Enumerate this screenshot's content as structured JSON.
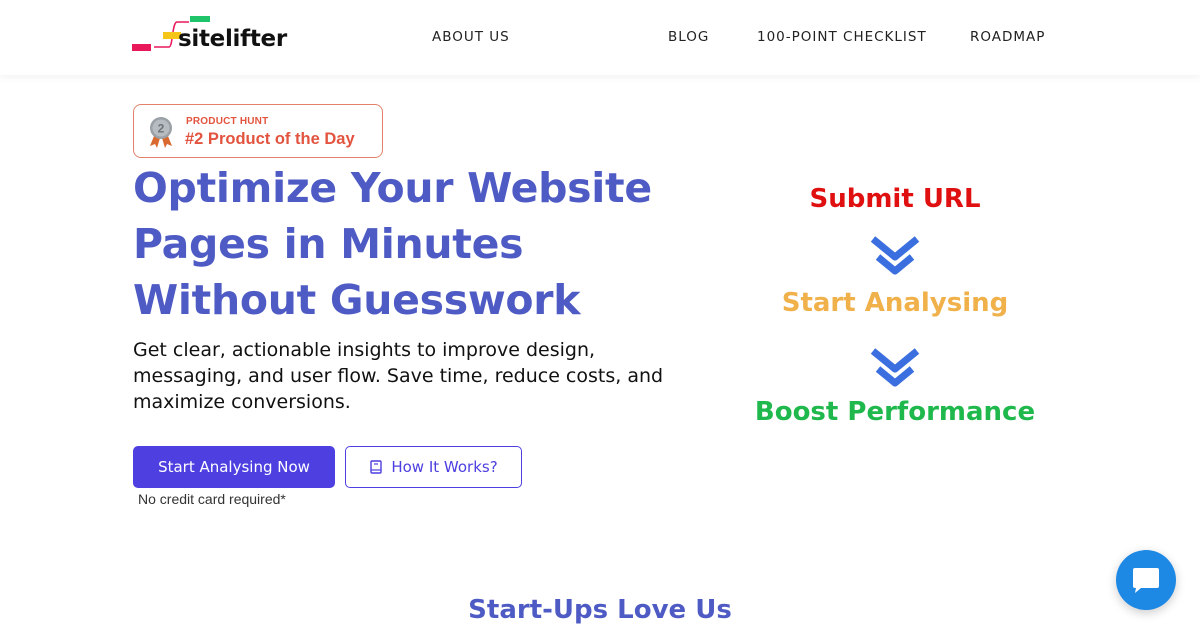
{
  "header": {
    "logo_text": "sitelifter",
    "nav": [
      {
        "label": "ABOUT US"
      },
      {
        "label": "BLOG"
      },
      {
        "label": "100-POINT CHECKLIST"
      },
      {
        "label": "ROADMAP"
      }
    ]
  },
  "badge": {
    "kicker": "PRODUCT HUNT",
    "title": "#2 Product of the Day",
    "medal_number": "2"
  },
  "hero": {
    "title": "Optimize Your Website Pages in Minutes Without Guesswork",
    "subtitle": "Get clear, actionable insights to improve design, messaging, and user flow. Save time, reduce costs, and maximize conversions.",
    "primary_cta": "Start Analysing Now",
    "secondary_cta": "How It Works?",
    "note": "No credit card required*"
  },
  "steps": [
    {
      "label": "Submit URL",
      "color": "#e01010"
    },
    {
      "label": "Start Analysing",
      "color": "#f0b04a"
    },
    {
      "label": "Boost Performance",
      "color": "#1fb84c"
    }
  ],
  "section": {
    "title": "Start-Ups Love Us"
  },
  "colors": {
    "brand_blue": "#4f5bc4",
    "cta": "#4d3fe0",
    "arrow": "#3b6fe0",
    "chat": "#1e88e5",
    "logo_pink": "#e8185a",
    "logo_yellow": "#f5c518",
    "logo_green": "#1fc46a"
  },
  "icons": {
    "secondary_cta_icon": "book-icon",
    "chat_icon": "chat-bubble-icon",
    "step_arrow_icon": "double-chevron-down-icon",
    "badge_icon": "medal-icon"
  }
}
